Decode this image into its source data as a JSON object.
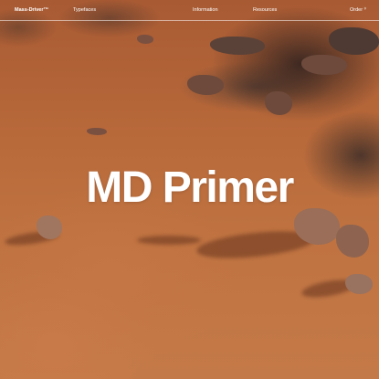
{
  "nav": {
    "brand": "Mass-Driver™",
    "items": [
      "Typefaces",
      "Information",
      "Resources"
    ],
    "order": "Order ⁰"
  },
  "hero": {
    "title": "MD Primer"
  },
  "background": {
    "description_colors": {
      "sand": "#b8693a",
      "rock": "#6d4a3c",
      "shadow": "#50231 4"
    }
  }
}
